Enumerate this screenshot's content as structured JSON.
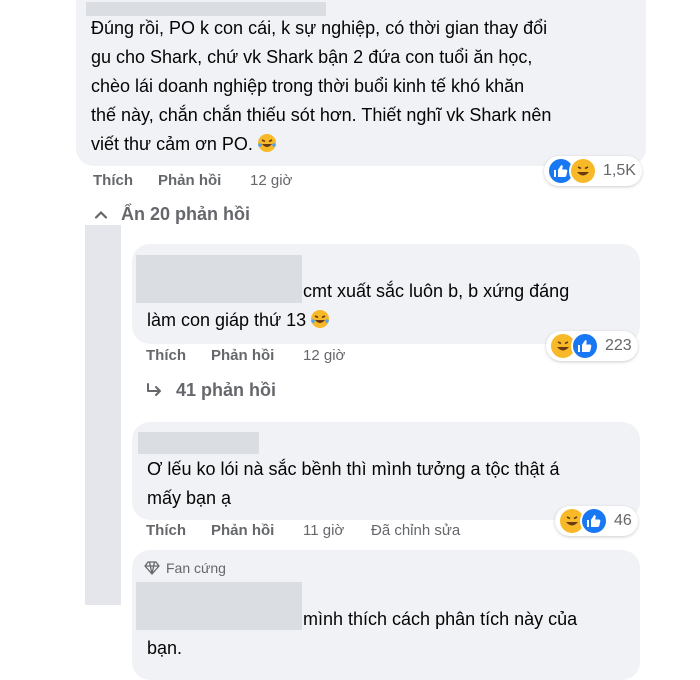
{
  "comment1": {
    "text_line1": "Đúng rồi, PO k con cái, k sự nghiệp, có thời gian thay đổi",
    "text_line2": "gu cho Shark, chứ vk Shark bận 2 đứa con tuổi ăn học,",
    "text_line3": "chèo lái doanh nghiệp trong thời buổi kinh tế khó khăn",
    "text_line4": "thế này, chắn chắn thiếu sót hơn. Thiết nghĩ vk Shark nên",
    "text_line5": "viết thư cảm ơn PO.",
    "like_label": "Thích",
    "reply_label": "Phản hồi",
    "time": "12 giờ",
    "reaction_count": "1,5K"
  },
  "hide_replies": {
    "label": "Ẩn 20 phản hồi"
  },
  "reply1": {
    "text_line1": "cmt xuất sắc luôn b, b xứng đáng",
    "text_line2": "làm con giáp thứ 13",
    "like_label": "Thích",
    "reply_label": "Phản hồi",
    "time": "12 giờ",
    "reaction_count": "223",
    "sub_replies": "41 phản hồi"
  },
  "reply2": {
    "text_line1": "Ơ lếu ko lói nà sắc bềnh thì mình tưởng a tộc thật á",
    "text_line2": "mấy bạn ạ",
    "like_label": "Thích",
    "reply_label": "Phản hồi",
    "time": "11 giờ",
    "edited": "Đã chỉnh sửa",
    "reaction_count": "46"
  },
  "reply3": {
    "badge": "Fan cứng",
    "text_line1": "mình thích cách phân tích này của",
    "text_line2": "bạn."
  },
  "colors": {
    "bubble": "#f0f2f5",
    "meta_text": "#65676b",
    "like_blue": "#1877f2",
    "haha_yellow": "#f7b928"
  }
}
